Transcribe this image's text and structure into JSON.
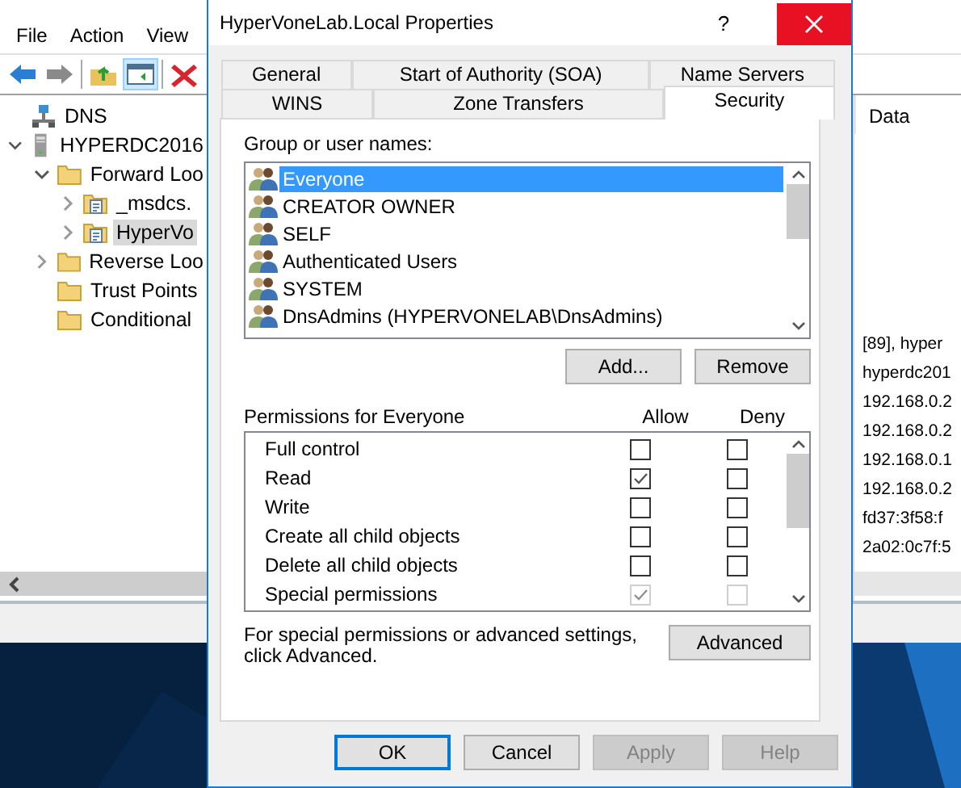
{
  "main_window": {
    "menu": [
      "File",
      "Action",
      "View"
    ],
    "tree": [
      {
        "label": "DNS",
        "kind": "dns",
        "children": [
          {
            "label": "HYPERDC2016",
            "kind": "server",
            "expanded": true,
            "selected": false,
            "children": [
              {
                "label": "Forward Loo",
                "kind": "folder",
                "expanded": true,
                "selected": false,
                "children": [
                  {
                    "label": "_msdcs.",
                    "kind": "zone",
                    "expanded": false,
                    "selected": false
                  },
                  {
                    "label": "HyperVo",
                    "kind": "zone",
                    "expanded": false,
                    "selected": true
                  }
                ]
              },
              {
                "label": "Reverse Loo",
                "kind": "folder",
                "expanded": false,
                "selected": false
              },
              {
                "label": "Trust Points",
                "kind": "folder",
                "selected": false
              },
              {
                "label": "Conditional",
                "kind": "folder",
                "selected": false
              }
            ]
          }
        ]
      }
    ],
    "data_column": {
      "header": "Data",
      "rows": [
        "[89], hyper",
        "hyperdc201",
        "192.168.0.2",
        "192.168.0.2",
        "192.168.0.1",
        "192.168.0.2",
        "fd37:3f58:f",
        "2a02:0c7f:5"
      ]
    }
  },
  "dialog": {
    "title": "HyperVoneLab.Local Properties",
    "help": "?",
    "tab_rows": [
      [
        {
          "label": "General",
          "selected": false
        },
        {
          "label": "Start of Authority (SOA)",
          "selected": false
        },
        {
          "label": "Name Servers",
          "selected": false
        }
      ],
      [
        {
          "label": "WINS",
          "selected": false
        },
        {
          "label": "Zone Transfers",
          "selected": false
        },
        {
          "label": "Security",
          "selected": true
        }
      ]
    ],
    "group_label": "Group or user names:",
    "principals": [
      {
        "name": "Everyone",
        "selected": true
      },
      {
        "name": "CREATOR OWNER",
        "selected": false
      },
      {
        "name": "SELF",
        "selected": false
      },
      {
        "name": "Authenticated Users",
        "selected": false
      },
      {
        "name": "SYSTEM",
        "selected": false
      },
      {
        "name": "DnsAdmins (HYPERVONELAB\\DnsAdmins)",
        "selected": false
      }
    ],
    "principal_buttons": [
      "Add...",
      "Remove"
    ],
    "permissions_label": "Permissions for Everyone",
    "allow_header": "Allow",
    "deny_header": "Deny",
    "permissions": [
      {
        "name": "Full control",
        "allow": false,
        "deny": false,
        "disabled": false
      },
      {
        "name": "Read",
        "allow": true,
        "deny": false,
        "disabled": false
      },
      {
        "name": "Write",
        "allow": false,
        "deny": false,
        "disabled": false
      },
      {
        "name": "Create all child objects",
        "allow": false,
        "deny": false,
        "disabled": false
      },
      {
        "name": "Delete all child objects",
        "allow": false,
        "deny": false,
        "disabled": false
      },
      {
        "name": "Special permissions",
        "allow": true,
        "deny": false,
        "disabled": true
      }
    ],
    "advanced_note": "For special permissions or advanced settings, click Advanced.",
    "advanced_button": "Advanced",
    "footer_buttons": [
      {
        "label": "OK",
        "default": true,
        "disabled": false
      },
      {
        "label": "Cancel",
        "default": false,
        "disabled": false
      },
      {
        "label": "Apply",
        "default": false,
        "disabled": true
      },
      {
        "label": "Help",
        "default": false,
        "disabled": true
      }
    ]
  }
}
